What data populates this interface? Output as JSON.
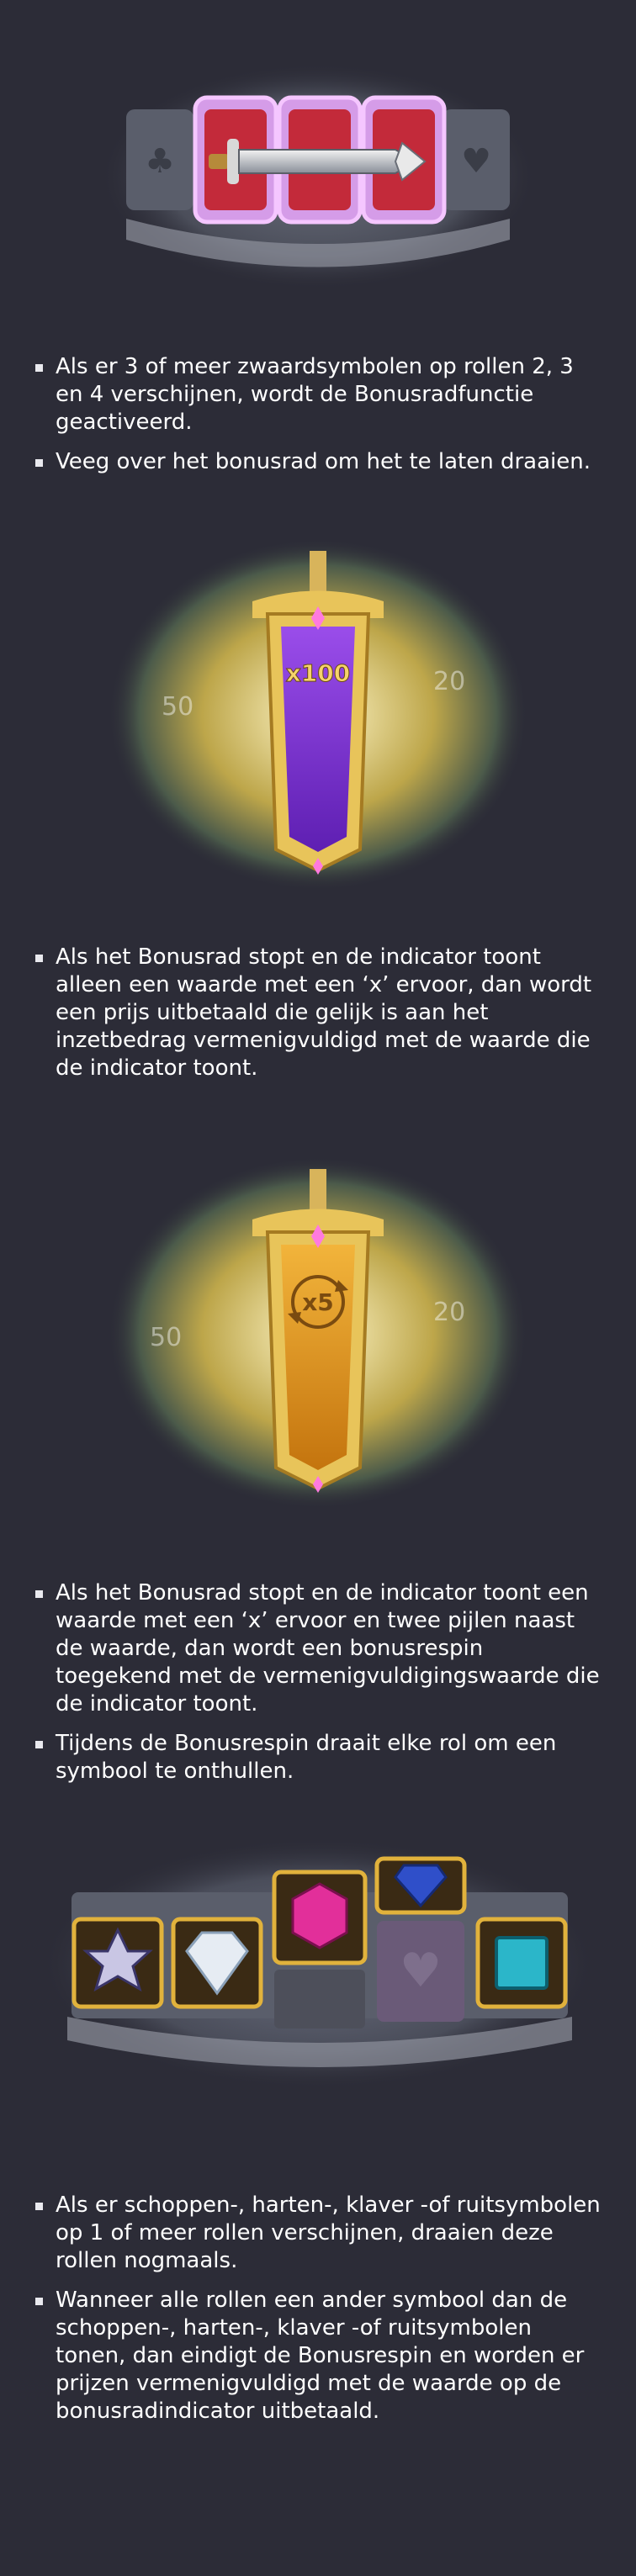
{
  "sections": [
    {
      "image": {
        "name": "sword-reels-image",
        "icon": "sword-icon"
      },
      "bullets": [
        "Als er 3 of meer zwaardsymbolen op rollen 2, 3 en 4 verschijnen, wordt de Bonusradfunctie geactiveerd.",
        "Veeg over het bonusrad om het te laten draaien."
      ]
    },
    {
      "image": {
        "name": "bonus-wheel-x100-image",
        "indicator": "x100",
        "left_value": "50",
        "right_value": "20"
      },
      "bullets": [
        "Als het Bonusrad stopt en de indicator toont alleen een waarde met een ‘x’ ervoor, dan wordt een prijs uitbetaald die gelijk is aan het inzetbedrag vermenigvuldigd met de waarde die de indicator toont."
      ]
    },
    {
      "image": {
        "name": "bonus-wheel-x5-image",
        "indicator": "x5",
        "left_value": "50",
        "right_value": "20"
      },
      "bullets": [
        "Als het Bonusrad stopt en de indicator toont een waarde met een ‘x’ ervoor en twee pijlen naast de waarde, dan wordt een bonusrespin toegekend met de vermenigvuldigingswaarde die de indicator toont.",
        "Tijdens de Bonusrespin draait elke rol om een symbool te onthullen."
      ]
    },
    {
      "image": {
        "name": "gem-reels-image",
        "icon": "gem-icon"
      },
      "bullets": [
        "Als er schoppen-, harten-, klaver -of ruitsymbolen op 1 of meer rollen verschijnen, draaien deze rollen nogmaals.",
        "Wanneer alle rollen een ander symbool dan de schoppen-, harten-, klaver -of ruitsymbolen tonen, dan eindigt de Bonusrespin en worden er prijzen vermenigvuldigd met de waarde op de bonusradindicator uitbetaald."
      ]
    }
  ],
  "colors": {
    "background": "#2c2c37",
    "text": "#ffffff",
    "gold": "#e8c45a",
    "purple": "#7a2fd0",
    "orange": "#e79a1d",
    "reel_red": "#c32a3a"
  }
}
